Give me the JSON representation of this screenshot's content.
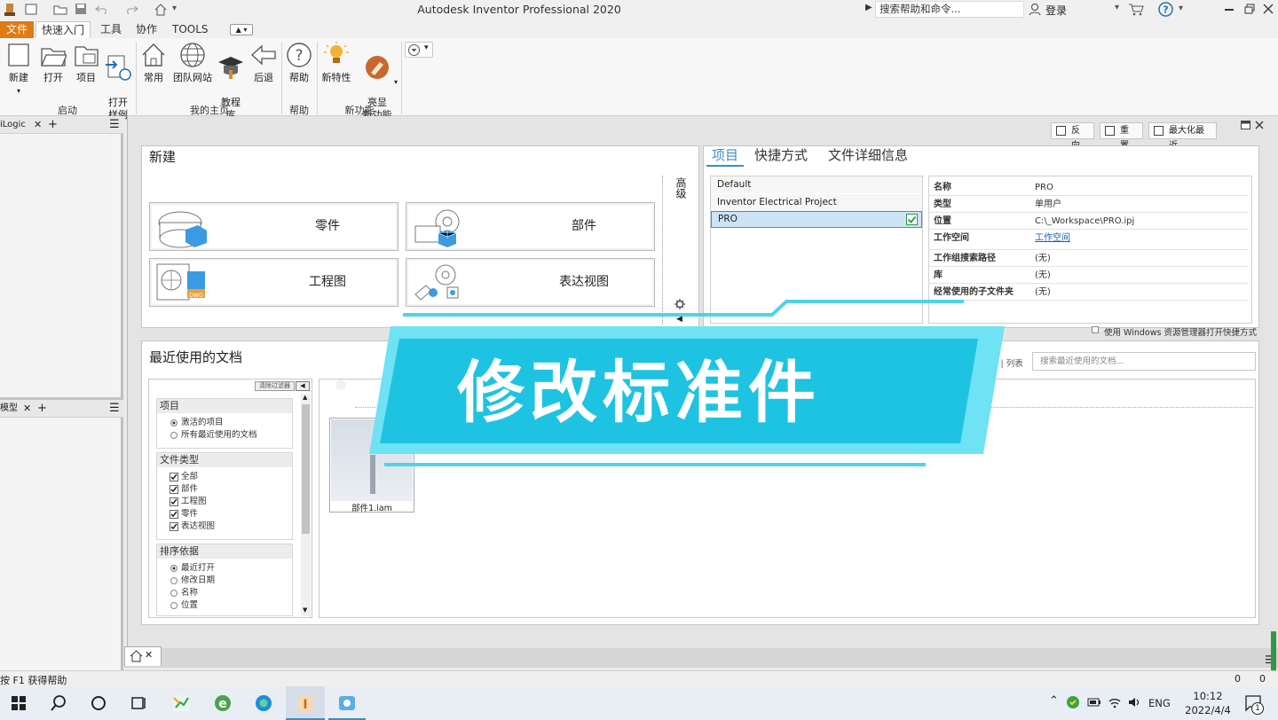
{
  "app": {
    "title": "Autodesk Inventor Professional 2020"
  },
  "titlebar": {
    "search_placeholder": "搜索帮助和命令...",
    "login": "登录",
    "help_label": "?"
  },
  "ribbon": {
    "tabs": [
      "文件",
      "快速入门",
      "工具",
      "协作",
      "TOOLS"
    ],
    "groups": [
      {
        "name": "启动",
        "buttons": [
          {
            "label": "新建",
            "icon": "new-file-icon"
          },
          {
            "label": "打开",
            "icon": "open-folder-icon"
          },
          {
            "label": "项目",
            "icon": "project-icon"
          },
          {
            "label": "打开\n样例",
            "icon": "open-sample-icon"
          }
        ]
      },
      {
        "name": "我的主页",
        "buttons": [
          {
            "label": "常用",
            "icon": "home-icon"
          },
          {
            "label": "团队网站",
            "icon": "globe-icon"
          },
          {
            "label": "教程\n库",
            "icon": "tutorial-icon"
          },
          {
            "label": "后退",
            "icon": "back-arrow-icon"
          }
        ]
      },
      {
        "name": "帮助",
        "buttons": [
          {
            "label": "帮助",
            "icon": "help-icon"
          }
        ]
      },
      {
        "name": "新功能",
        "buttons": [
          {
            "label": "新特性",
            "icon": "lightbulb-icon"
          },
          {
            "label": "亮显\n新功能",
            "icon": "highlight-icon"
          }
        ]
      }
    ]
  },
  "left_panel": {
    "tab1": "iLogic",
    "tab2": "模型"
  },
  "toolbar": {
    "reverse": "反向",
    "reset": "重置",
    "maximize_recent": "最大化最近"
  },
  "new_section": {
    "title": "新建",
    "cards": [
      "零件",
      "部件",
      "工程图",
      "表达视图"
    ],
    "advanced": "高级"
  },
  "project_section": {
    "tabs": [
      "项目",
      "快捷方式",
      "文件详细信息"
    ],
    "projects": [
      "Default",
      "Inventor Electrical Project",
      "PRO"
    ],
    "properties": [
      {
        "k": "名称",
        "v": "PRO"
      },
      {
        "k": "类型",
        "v": "单用户"
      },
      {
        "k": "位置",
        "v": "C:\\_Workspace\\PRO.ipj"
      },
      {
        "k": "工作空间",
        "v": "工作空间"
      },
      {
        "k": "工作组搜索路径",
        "v": "(无)"
      },
      {
        "k": "库",
        "v": "(无)"
      },
      {
        "k": "经常使用的子文件夹",
        "v": "(无)"
      }
    ],
    "checkbox_label": "使用 Windows 资源管理器打开快捷方式"
  },
  "recent_section": {
    "title": "最近使用的文档",
    "clear_filters": "清除过滤器",
    "view_label": "小 | 列表",
    "search_placeholder": "搜索最近使用的文档...",
    "filters": {
      "project_header": "项目",
      "project_options": [
        "激活的项目",
        "所有最近使用的文档"
      ],
      "filetype_header": "文件类型",
      "filetype_options": [
        "全部",
        "部件",
        "工程图",
        "零件",
        "表达视图"
      ],
      "sort_header": "排序依据",
      "sort_options": [
        "最近打开",
        "修改日期",
        "名称",
        "位置"
      ]
    },
    "file": {
      "name": "部件1.iam"
    }
  },
  "overlay": {
    "text": "修改标准件"
  },
  "statusbar": {
    "help": "按 F1 获得帮助",
    "count1": "0",
    "count2": "0"
  },
  "taskbar": {
    "language": "ENG",
    "time": "10:12",
    "date": "2022/4/4",
    "notif_count": "1"
  },
  "colors": {
    "accent": "#3c8dc7",
    "banner": "#1fc3e2",
    "banner_light": "#6fe2f3",
    "selection_bg": "#cde4f7"
  }
}
